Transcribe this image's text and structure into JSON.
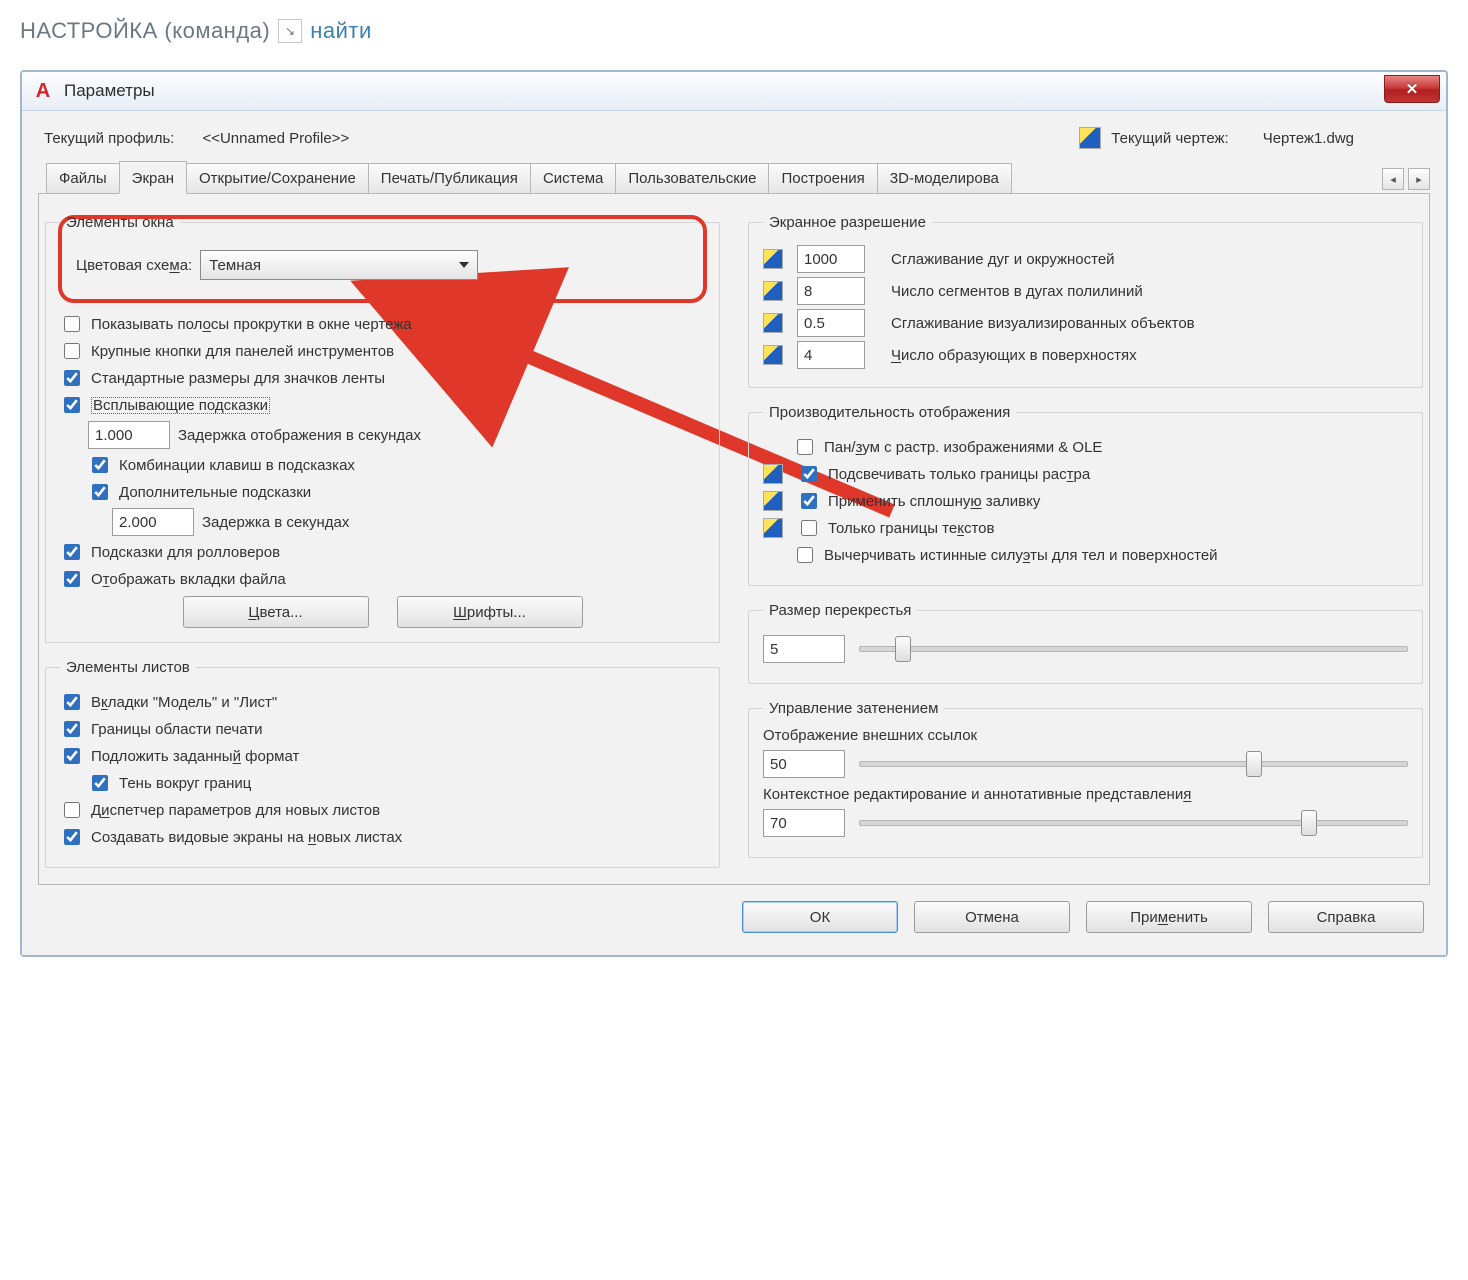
{
  "page_header": {
    "title": "НАСТРОЙКА (команда)",
    "find": "найти"
  },
  "dialog": {
    "title": "Параметры",
    "profile_label": "Текущий профиль:",
    "profile_value": "<<Unnamed Profile>>",
    "drawing_label": "Текущий чертеж:",
    "drawing_value": "Чертеж1.dwg",
    "tabs": [
      "Файлы",
      "Экран",
      "Открытие/Сохранение",
      "Печать/Публикация",
      "Система",
      "Пользовательские",
      "Построения",
      "3D-моделирова"
    ],
    "active_tab_index": 1,
    "footer": {
      "ok": "ОК",
      "cancel": "Отмена",
      "apply": "Применить",
      "help": "Справка"
    }
  },
  "window_elements": {
    "legend": "Элементы окна",
    "color_scheme_label": "Цветовая схема:",
    "color_scheme_value": "Темная",
    "scrollbars": "Показывать полосы прокрутки в окне чертежа",
    "large_buttons": "Крупные кнопки для панелей инструментов",
    "ribbon_icons": "Стандартные размеры для значков ленты",
    "tooltips": "Всплывающие подсказки",
    "tooltip_delay_value": "1.000",
    "tooltip_delay_label": "Задержка отображения в секундах",
    "shortcut_keys": "Комбинации клавиш в подсказках",
    "ext_tooltips": "Дополнительные подсказки",
    "ext_delay_value": "2.000",
    "ext_delay_label": "Задержка в секундах",
    "rollover": "Подсказки для ролловеров",
    "file_tabs": "Отображать вкладки файла",
    "colors_btn": "Цвета...",
    "fonts_btn": "Шрифты..."
  },
  "layout_elements": {
    "legend": "Элементы листов",
    "model_layout_tabs": "Вкладки \"Модель\" и \"Лист\"",
    "print_area": "Границы области печати",
    "paper_bg": "Подложить заданный формат",
    "shadow": "Тень вокруг границ",
    "page_setup_mgr": "Диспетчер параметров для новых листов",
    "create_viewports": "Создавать видовые экраны на новых листах"
  },
  "display_res": {
    "legend": "Экранное разрешение",
    "arc_value": "1000",
    "arc_label": "Сглаживание дуг и окружностей",
    "seg_value": "8",
    "seg_label": "Число сегментов в дугах полилиний",
    "render_value": "0.5",
    "render_label": "Сглаживание визуализированных объектов",
    "surf_value": "4",
    "surf_label": "Число образующих в поверхностях"
  },
  "display_perf": {
    "legend": "Производительность отображения",
    "pan_zoom": "Пан/зум с растр. изображениями & OLE",
    "raster_frame": "Подсвечивать только границы растра",
    "solid_fill": "Применить сплошную заливку",
    "text_boundary": "Только границы текстов",
    "true_silh": "Вычерчивать истинные силуэты для тел и поверхностей"
  },
  "crosshair": {
    "legend": "Размер перекрестья",
    "value": "5"
  },
  "fade": {
    "legend": "Управление затенением",
    "xref_label": "Отображение внешних ссылок",
    "xref_value": "50",
    "inplace_label": "Контекстное редактирование и аннотативные представления",
    "inplace_value": "70"
  }
}
